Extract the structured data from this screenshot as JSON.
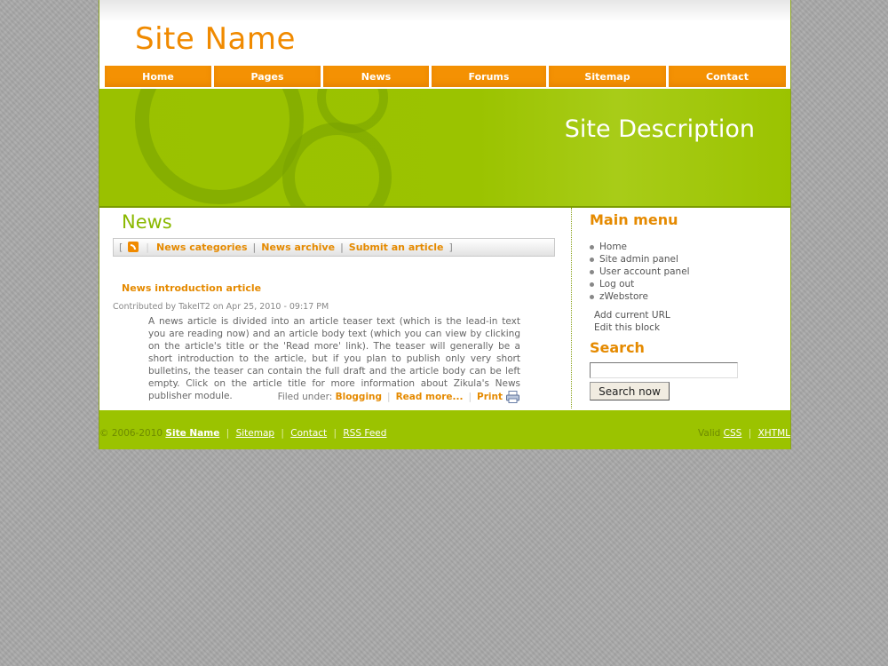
{
  "header": {
    "site_name": "Site Name"
  },
  "nav": [
    "Home",
    "Pages",
    "News",
    "Forums",
    "Sitemap",
    "Contact"
  ],
  "banner": {
    "description": "Site Description"
  },
  "news": {
    "title": "News",
    "subnav": {
      "categories": "News categories",
      "archive": "News archive",
      "submit": "Submit an article"
    },
    "article": {
      "title": "News introduction article",
      "meta": "Contributed by TakeIT2 on Apr 25, 2010 - 09:17 PM",
      "body": "A news article is divided into an article teaser text (which is the lead-in text you are reading now) and an article body text (which you can view by clicking on the article's title or the 'Read more' link). The teaser will generally be a short introduction to the article, but if you plan to publish only very short bulletins, the teaser can contain the full draft and the article body can be left empty. Click on the article title for more information about Zikula's News publisher module.",
      "filed_label": "Filed under:",
      "category": "Blogging",
      "read_more": "Read more...",
      "print": "Print"
    }
  },
  "sidebar": {
    "menu_title": "Main menu",
    "menu_items": [
      "Home",
      "Site admin panel",
      "User account panel",
      "Log out",
      "zWebstore"
    ],
    "add_url": "Add current URL",
    "edit_block": "Edit this block",
    "search_title": "Search",
    "search_value": "",
    "search_button": "Search now"
  },
  "footer": {
    "copyright": "© 2006-2010",
    "site_name": "Site Name",
    "links": [
      "Sitemap",
      "Contact",
      "RSS Feed"
    ],
    "valid": "Valid",
    "css": "CSS",
    "xhtml": "XHTML"
  },
  "colors": {
    "orange": "#f49103",
    "green": "#9bc300",
    "background": "#a9a9a9"
  },
  "icons": [
    "rss-icon",
    "printer-icon"
  ]
}
